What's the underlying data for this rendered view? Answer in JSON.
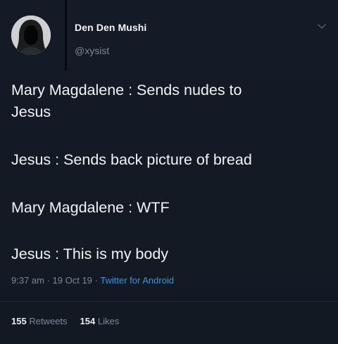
{
  "user": {
    "display_name": "Den Den Mushi",
    "handle": "@xysist",
    "avatar_icon": "hooded-figure-avatar"
  },
  "tweet": {
    "lines": [
      "Mary Magdalene : Sends nudes to",
      "Jesus",
      "Jesus : Sends back picture of bread",
      "Mary Magdalene : WTF",
      "Jesus : This is my body"
    ]
  },
  "meta": {
    "time": "9:37 am",
    "sep1": " · ",
    "date": "19 Oct 19",
    "sep2": " · ",
    "source": "Twitter for Android"
  },
  "stats": {
    "retweets_count": "155",
    "retweets_label": "Retweets",
    "likes_count": "154",
    "likes_label": "Likes"
  },
  "colors": {
    "background": "#141a24",
    "text": "#f1f3f6",
    "muted": "#7d8896",
    "link": "#3a94d8"
  }
}
